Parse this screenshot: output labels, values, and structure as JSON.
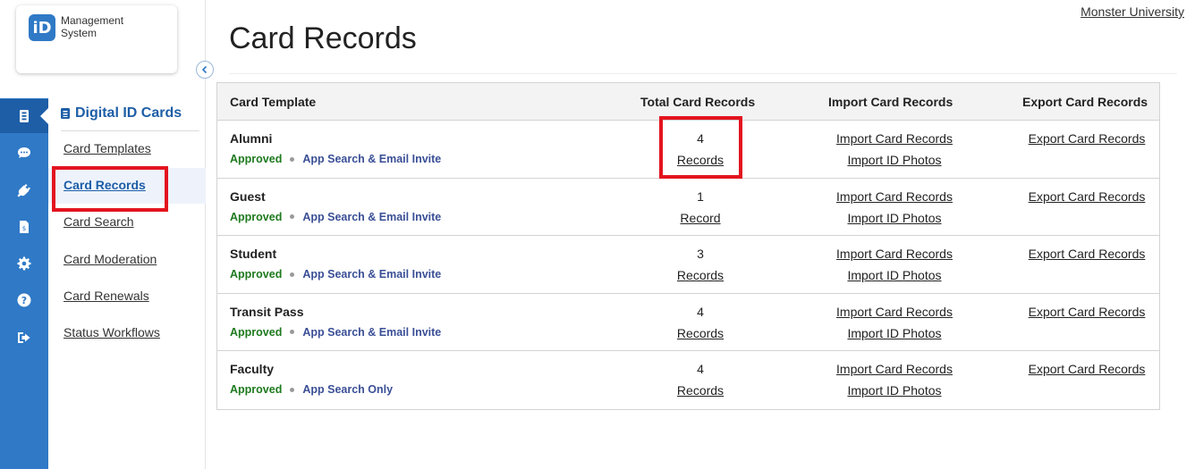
{
  "logo": {
    "badge": "iD",
    "line1": "Management",
    "line2": "System"
  },
  "org_link": "Monster University",
  "rail": {
    "items": [
      {
        "icon": "id-card-icon"
      },
      {
        "icon": "chat-icon"
      },
      {
        "icon": "plug-icon"
      },
      {
        "icon": "invoice-icon"
      },
      {
        "icon": "gear-icon"
      },
      {
        "icon": "help-icon"
      },
      {
        "icon": "logout-icon"
      }
    ]
  },
  "sidebar": {
    "title": "Digital ID Cards",
    "items": [
      {
        "label": "Card Templates"
      },
      {
        "label": "Card Records"
      },
      {
        "label": "Card Search"
      },
      {
        "label": "Card Moderation"
      },
      {
        "label": "Card Renewals"
      },
      {
        "label": "Status Workflows"
      }
    ]
  },
  "page": {
    "title": "Card Records"
  },
  "table": {
    "headers": {
      "template": "Card Template",
      "total": "Total Card Records",
      "import": "Import Card Records",
      "export": "Export Card Records"
    },
    "rows": [
      {
        "name": "Alumni",
        "status": "Approved",
        "access": "App Search & Email Invite",
        "count": "4",
        "records_label": "Records",
        "import_records": "Import Card Records",
        "import_photos": "Import ID Photos",
        "export_records": "Export Card Records"
      },
      {
        "name": "Guest",
        "status": "Approved",
        "access": "App Search & Email Invite",
        "count": "1",
        "records_label": "Record",
        "import_records": "Import Card Records",
        "import_photos": "Import ID Photos",
        "export_records": "Export Card Records"
      },
      {
        "name": "Student",
        "status": "Approved",
        "access": "App Search & Email Invite",
        "count": "3",
        "records_label": "Records",
        "import_records": "Import Card Records",
        "import_photos": "Import ID Photos",
        "export_records": "Export Card Records"
      },
      {
        "name": "Transit Pass",
        "status": "Approved",
        "access": "App Search & Email Invite",
        "count": "4",
        "records_label": "Records",
        "import_records": "Import Card Records",
        "import_photos": "Import ID Photos",
        "export_records": "Export Card Records"
      },
      {
        "name": "Faculty",
        "status": "Approved",
        "access": "App Search Only",
        "count": "4",
        "records_label": "Records",
        "import_records": "Import Card Records",
        "import_photos": "Import ID Photos",
        "export_records": "Export Card Records"
      }
    ]
  },
  "colors": {
    "brand": "#2f79c6",
    "brand_dark": "#1d5ea7",
    "highlight": "#e3141f",
    "approved": "#1e7a1e",
    "access": "#3a4f96"
  }
}
